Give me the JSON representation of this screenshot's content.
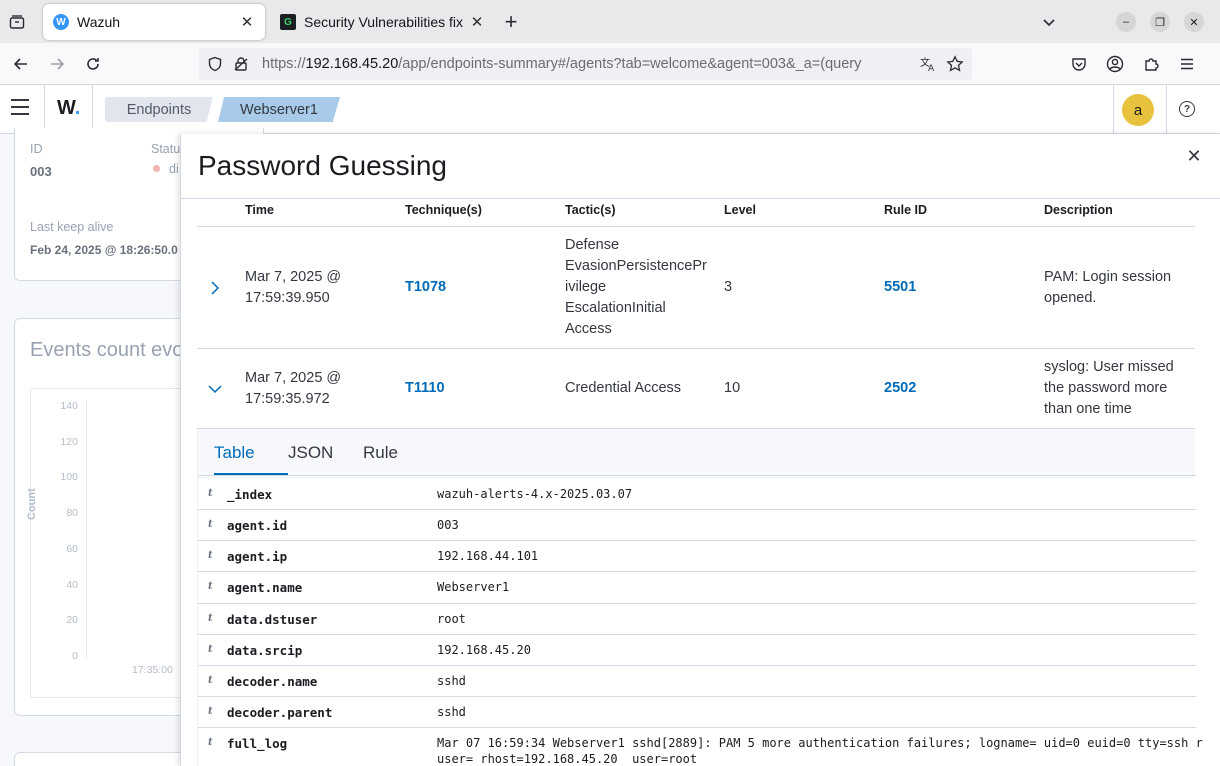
{
  "browser": {
    "tabs": [
      {
        "title": "Wazuh",
        "favicon": "W"
      },
      {
        "title": "Security Vulnerabilities fix",
        "favicon": "G"
      }
    ],
    "url_prefix": "https://",
    "url_host": "192.168.45.20",
    "url_path": "/app/endpoints-summary#/agents?tab=welcome&agent=003&_a=(query"
  },
  "header": {
    "logo": "W",
    "breadcrumbs": [
      "Endpoints",
      "Webserver1"
    ],
    "avatar_letter": "a",
    "help": "?"
  },
  "background": {
    "id_label": "ID",
    "id_value": "003",
    "status_label": "Status",
    "status_value": "di",
    "keepalive_label": "Last keep alive",
    "keepalive_value": "Feb 24, 2025 @ 18:26:50.0",
    "events_title": "Events count evo",
    "y_axis_label": "Count",
    "y_ticks": [
      "140",
      "120",
      "100",
      "80",
      "60",
      "40",
      "20",
      "0"
    ],
    "x_tick": "17:35:00"
  },
  "flyout": {
    "title": "Password Guessing",
    "columns": [
      "Time",
      "Technique(s)",
      "Tactic(s)",
      "Level",
      "Rule ID",
      "Description"
    ],
    "rows": [
      {
        "time_line1": "Mar 7, 2025 @",
        "time_line2": "17:59:39.950",
        "technique": "T1078",
        "tactic_lines": [
          "Defense",
          "EvasionPersistencePr",
          "ivilege",
          "EscalationInitial",
          "Access"
        ],
        "level": "3",
        "rule_id": "5501",
        "desc_lines": [
          "PAM: Login session",
          "opened."
        ]
      },
      {
        "time_line1": "Mar 7, 2025 @",
        "time_line2": "17:59:35.972",
        "technique": "T1110",
        "tactic_lines": [
          "Credential Access"
        ],
        "level": "10",
        "rule_id": "2502",
        "desc_lines": [
          "syslog: User missed",
          "the password more",
          "than one time"
        ]
      }
    ],
    "detail_tabs": [
      "Table",
      "JSON",
      "Rule"
    ],
    "fields": [
      {
        "type": "t",
        "key": "_index",
        "value": "wazuh-alerts-4.x-2025.03.07"
      },
      {
        "type": "t",
        "key": "agent.id",
        "value": "003"
      },
      {
        "type": "t",
        "key": "agent.ip",
        "value": "192.168.44.101"
      },
      {
        "type": "t",
        "key": "agent.name",
        "value": "Webserver1"
      },
      {
        "type": "t",
        "key": "data.dstuser",
        "value": "root"
      },
      {
        "type": "t",
        "key": "data.srcip",
        "value": "192.168.45.20"
      },
      {
        "type": "t",
        "key": "decoder.name",
        "value": "sshd"
      },
      {
        "type": "t",
        "key": "decoder.parent",
        "value": "sshd"
      },
      {
        "type": "t",
        "key": "full_log",
        "value": "Mar 07 16:59:34 Webserver1 sshd[2889]: PAM 5 more authentication failures; logname= uid=0 euid=0 tty=ssh r",
        "value2": "user= rhost=192.168.45.20  user=root"
      }
    ]
  },
  "colors": {
    "link": "#006bb8",
    "avatar": "#e7c23d",
    "breadcrumb_active": "#a7cbe8"
  }
}
